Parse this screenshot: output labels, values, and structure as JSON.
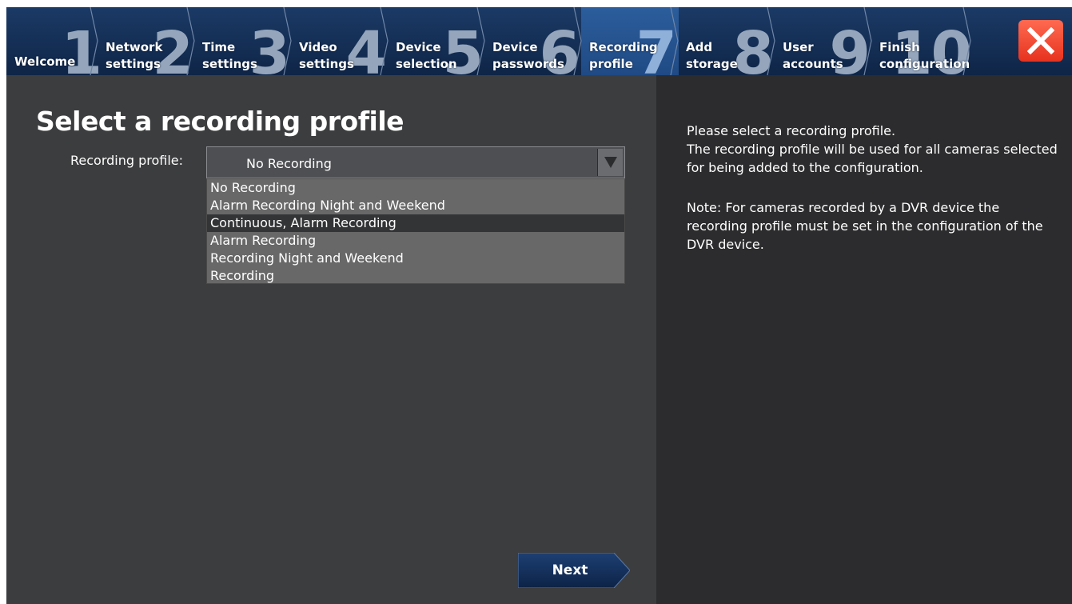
{
  "colors": {
    "header_bg": "#13305a",
    "active_step_bg": "#2a5a98",
    "close_button_bg": "#f04a33",
    "main_bg": "#3c3d3f",
    "help_bg": "#2c2c2e",
    "selected_option_bg": "#333436",
    "next_button_bg": "#143262"
  },
  "header": {
    "steps": [
      {
        "number": "1",
        "label": "Welcome",
        "active": false
      },
      {
        "number": "2",
        "label": "Network\nsettings",
        "active": false
      },
      {
        "number": "3",
        "label": "Time\nsettings",
        "active": false
      },
      {
        "number": "4",
        "label": "Video\nsettings",
        "active": false
      },
      {
        "number": "5",
        "label": "Device\nselection",
        "active": false
      },
      {
        "number": "6",
        "label": "Device\npasswords",
        "active": false
      },
      {
        "number": "7",
        "label": "Recording\nprofile",
        "active": true
      },
      {
        "number": "8",
        "label": "Add\nstorage",
        "active": false
      },
      {
        "number": "9",
        "label": "User\naccounts",
        "active": false
      },
      {
        "number": "10",
        "label": "Finish\nconfiguration",
        "active": false
      }
    ],
    "close_icon": "close-x-icon"
  },
  "main": {
    "title": "Select a recording profile",
    "profile_label": "Recording profile:",
    "select": {
      "value": "No Recording",
      "arrow_icon": "triangle-down-icon"
    },
    "options": [
      {
        "label": "No Recording",
        "selected": false
      },
      {
        "label": "Alarm Recording Night and Weekend",
        "selected": false
      },
      {
        "label": "Continuous, Alarm Recording",
        "selected": true
      },
      {
        "label": "Alarm Recording",
        "selected": false
      },
      {
        "label": "Recording Night and Weekend",
        "selected": false
      },
      {
        "label": "Recording",
        "selected": false
      }
    ],
    "next_label": "Next"
  },
  "help": {
    "paragraph1": "Please select a recording profile.\nThe recording profile will be used for all cameras selected for being added to the configuration.",
    "paragraph2": "Note: For cameras recorded by a DVR device the recording profile must be set in the configuration of the DVR device."
  }
}
